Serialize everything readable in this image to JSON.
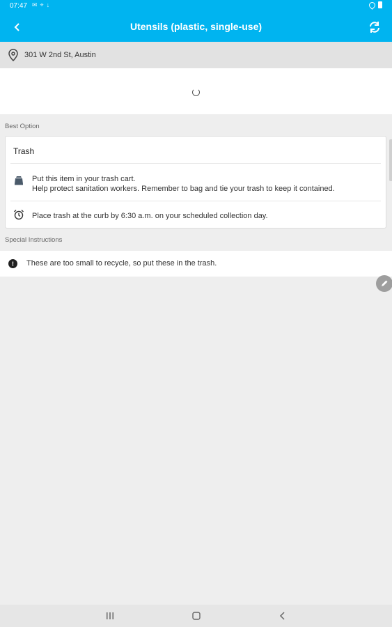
{
  "status_bar": {
    "time": "07:47",
    "left_icons": [
      "notification-icon",
      "location-icon",
      "download-icon"
    ],
    "right_icons": [
      "wifi-icon",
      "battery-icon"
    ]
  },
  "app_bar": {
    "title": "Utensils (plastic, single-use)",
    "back_icon": "chevron-left-icon",
    "refresh_icon": "refresh-icon"
  },
  "address": {
    "icon": "location-pin-icon",
    "text": "301 W 2nd St, Austin"
  },
  "best_option": {
    "section_label": "Best Option",
    "title": "Trash",
    "rows": [
      {
        "icon": "trash-cart-icon",
        "line1": "Put this item in your trash cart.",
        "line2": "Help protect sanitation workers. Remember to bag and tie your trash to keep it contained."
      },
      {
        "icon": "alarm-clock-icon",
        "line1": "Place trash at the curb by 6:30 a.m. on your scheduled collection day."
      }
    ]
  },
  "special_instructions": {
    "section_label": "Special Instructions",
    "icon": "alert-icon",
    "text": "These are too small to recycle, so put these in the trash."
  },
  "nav_bar": {
    "icons": [
      "recent-apps-icon",
      "home-icon",
      "back-icon"
    ]
  },
  "colors": {
    "primary": "#00b4f0",
    "background": "#eeeeee",
    "card": "#ffffff"
  }
}
